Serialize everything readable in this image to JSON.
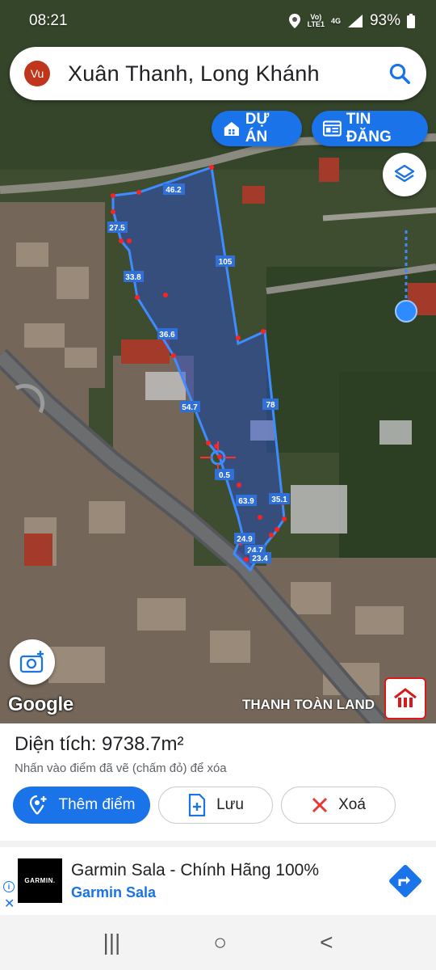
{
  "status": {
    "time": "08:21",
    "network_top": "Vo)",
    "network_bottom": "LTE1",
    "signal_type": "4G",
    "battery": "93%"
  },
  "search": {
    "avatar_initials": "Vu",
    "title": "Xuân Thanh, Long Khánh"
  },
  "chips": {
    "du_an": "DỰ ÁN",
    "tin_dang": "TIN ĐĂNG"
  },
  "map": {
    "edge_labels": [
      "46.2",
      "27.5",
      "33.8",
      "36.6",
      "54.7",
      "105",
      "78",
      "0.5",
      "63.9",
      "35.1",
      "24.9",
      "24.7",
      "23.4"
    ],
    "attribution": "Google",
    "watermark": "THANH TOÀN LAND",
    "brand_logo_text": "THANH TOÀN LAND",
    "colors": {
      "polygon_stroke": "#3f8cff",
      "polygon_fill": "#2b4fd9",
      "vertex": "#ff2020",
      "label_bg": "#2f6fd6"
    }
  },
  "sheet": {
    "area_label": "Diện tích: 9738.7m²",
    "hint": "Nhấn vào điểm đã vẽ (chấm đỏ) để xóa",
    "add_point": "Thêm điểm",
    "save": "Lưu",
    "delete": "Xoá"
  },
  "ad": {
    "logo": "GARMIN.",
    "title": "Garmin Sala - Chính Hãng 100%",
    "advertiser": "Garmin Sala",
    "info_icon": "i",
    "close_icon": "✕"
  },
  "nav": {
    "recents": "|||",
    "home": "○",
    "back": "<"
  }
}
